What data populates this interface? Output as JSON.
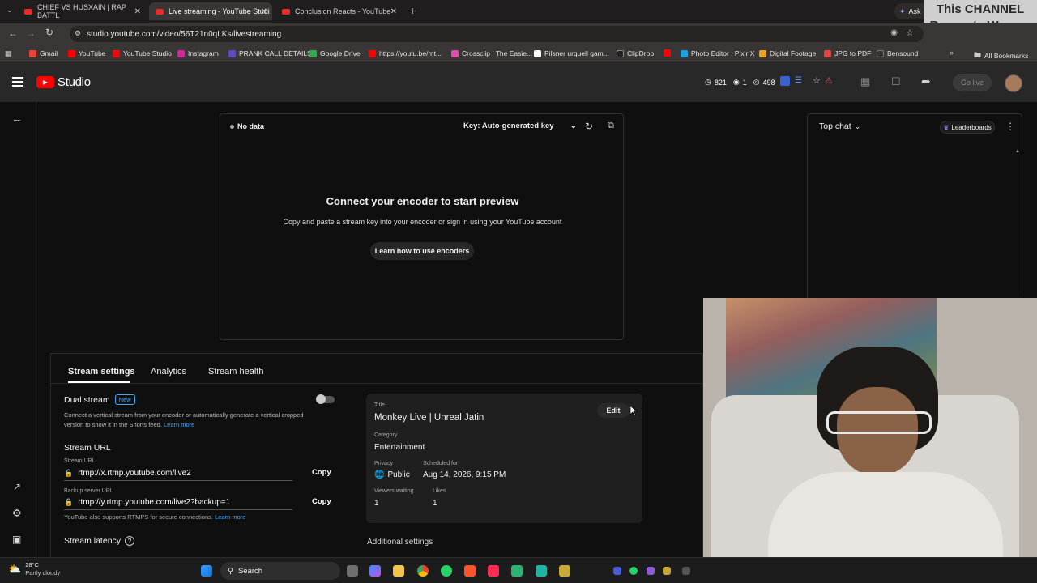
{
  "browser": {
    "tabs": [
      {
        "label": "CHIEF VS HUSXAIN | RAP BATTL"
      },
      {
        "label": "Live streaming - YouTube Studi"
      },
      {
        "label": "Conclusion Reacts - YouTube"
      }
    ],
    "new_tab": "+",
    "address": "studio.youtube.com/video/56T21n0qLKs/livestreaming",
    "ask_label": "Ask",
    "bookmarks": [
      {
        "label": "Gmail",
        "color": "#ea4335"
      },
      {
        "label": "YouTube",
        "color": "#ff0000"
      },
      {
        "label": "YouTube Studio",
        "color": "#ff0000"
      },
      {
        "label": "Instagram",
        "color": "#d6249f"
      },
      {
        "label": "PRANK CALL DETAILS",
        "color": "#5b4bc4"
      },
      {
        "label": "Google Drive",
        "color": "#34a853"
      },
      {
        "label": "https://youtu.be/mt...",
        "color": "#ff0000"
      },
      {
        "label": "Crossclip | The Easie...",
        "color": "#e14bb2"
      },
      {
        "label": "Pilsner urquell gam...",
        "color": "#ffffff"
      },
      {
        "label": "ClipDrop",
        "color": "#222222"
      },
      {
        "label": "",
        "color": "#ff0000"
      },
      {
        "label": "Photo Editor : Pixlr X",
        "color": "#1ea1e0"
      },
      {
        "label": "Digital Footage",
        "color": "#f0a020"
      },
      {
        "label": "JPG to PDF",
        "color": "#e8453c"
      },
      {
        "label": "Bensound",
        "color": "#333333"
      }
    ],
    "all_bookmarks": "All Bookmarks"
  },
  "watermark": {
    "line1": "This CHANNEL",
    "line2": "Respects Women"
  },
  "studio": {
    "logo_text": "Studio",
    "stats": {
      "concurrent": "821",
      "one": "1",
      "views": "498"
    },
    "go_live": "Go live"
  },
  "preview": {
    "status": "No data",
    "key_label": "Key: Auto-generated key",
    "heading": "Connect your encoder to start preview",
    "subtext": "Copy and paste a stream key into your encoder or sign in using your YouTube account",
    "learn_button": "Learn how to use encoders"
  },
  "chat": {
    "title": "Top chat",
    "leaderboards": "Leaderboards"
  },
  "settings": {
    "tabs": [
      "Stream settings",
      "Analytics",
      "Stream health"
    ],
    "dual_stream": {
      "title": "Dual stream",
      "badge": "New",
      "desc1": "Connect a vertical stream from your encoder or automatically generate a vertical cropped",
      "desc2": "version to show it in the Shorts feed.",
      "learn": "Learn more"
    },
    "stream_url_title": "Stream URL",
    "stream_url_label": "Stream URL",
    "stream_url": "rtmp://x.rtmp.youtube.com/live2",
    "backup_label": "Backup server URL",
    "backup_url": "rtmp://y.rtmp.youtube.com/live2?backup=1",
    "copy": "Copy",
    "rtmps_note": "YouTube also supports RTMPS for secure connections.",
    "rtmps_learn": "Learn more",
    "latency": "Stream latency",
    "additional": "Additional settings"
  },
  "card": {
    "title_label": "Title",
    "title": "Monkey Live | Unreal Jatin",
    "edit": "Edit",
    "category_label": "Category",
    "category": "Entertainment",
    "privacy_label": "Privacy",
    "privacy": "Public",
    "scheduled_label": "Scheduled for",
    "scheduled": "Aug 14, 2026, 9:15 PM",
    "viewers_label": "Viewers waiting",
    "viewers": "1",
    "likes_label": "Likes",
    "likes": "1"
  },
  "taskbar": {
    "weather_temp": "28°C",
    "weather_desc": "Partly cloudy",
    "search": "Search"
  }
}
